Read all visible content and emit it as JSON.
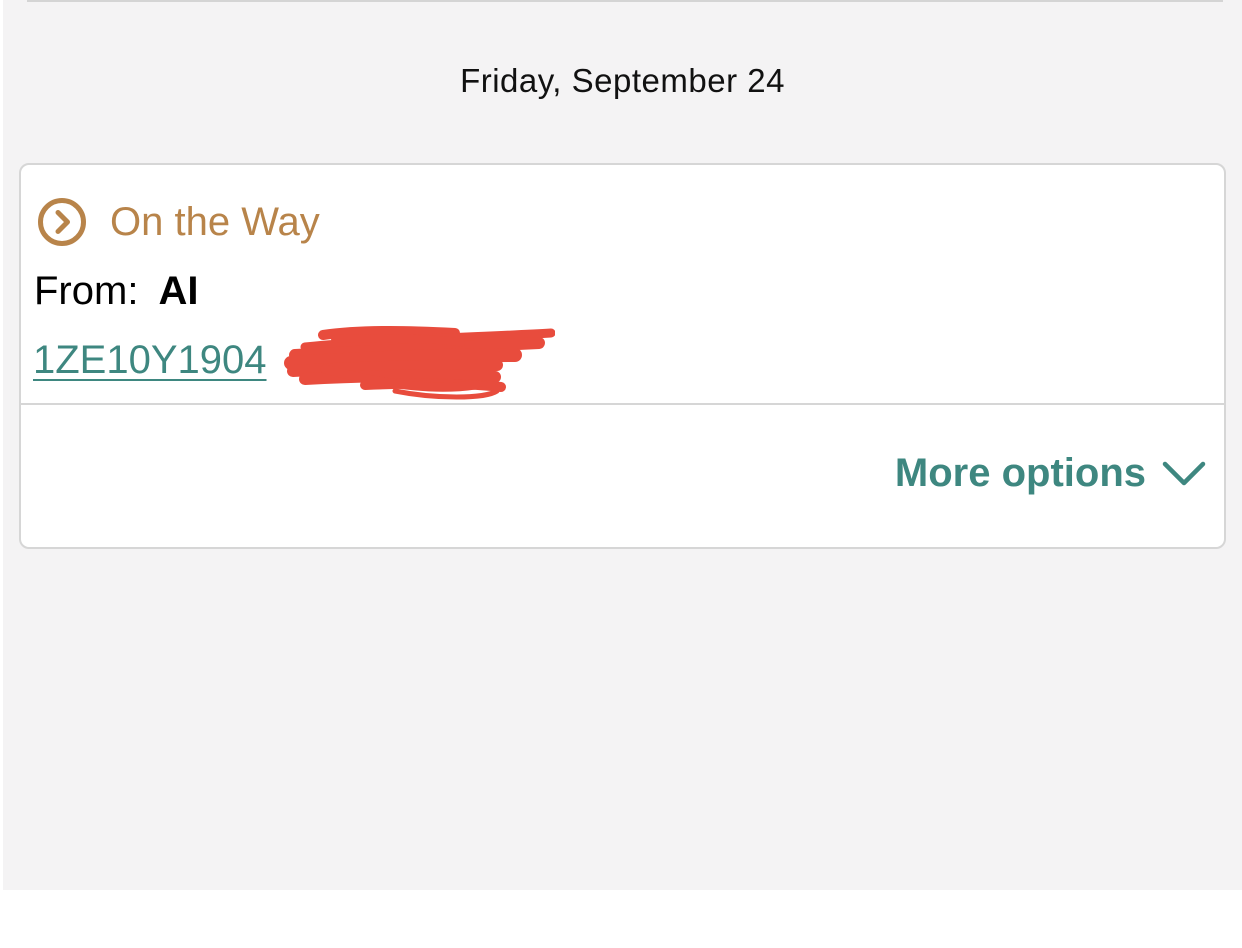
{
  "date_header": "Friday, September 24",
  "shipment": {
    "status_icon": "chevron-circle-right-icon",
    "status": "On the Way",
    "from_label": "From:",
    "from_name": "AI",
    "tracking_number": "1ZE10Y1904",
    "more_options_label": "More options",
    "more_options_icon": "chevron-down-icon"
  },
  "colors": {
    "status_accent": "#b8844a",
    "link_teal": "#3e8780",
    "redaction_red": "#e84c3d",
    "background": "#f4f3f4"
  }
}
